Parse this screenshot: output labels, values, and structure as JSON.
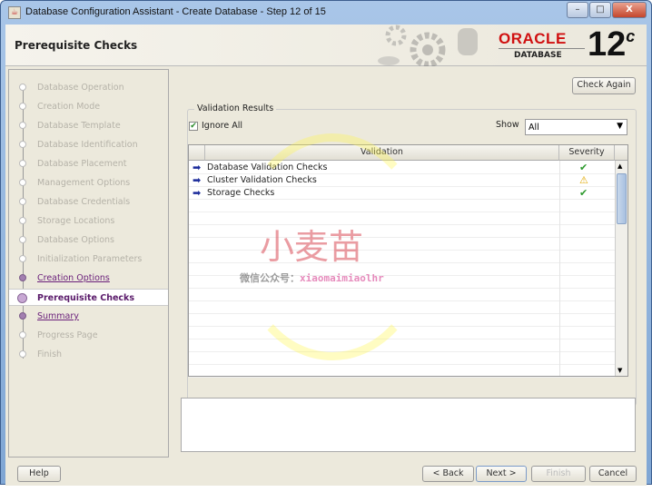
{
  "window": {
    "title": "Database Configuration Assistant - Create Database - Step 12 of 15",
    "minimize": "–",
    "maximize": "□",
    "close": "X"
  },
  "header": {
    "page_title": "Prerequisite Checks",
    "brand": "ORACLE",
    "product": "DATABASE",
    "version": "12",
    "version_suffix": "c"
  },
  "sidebar": {
    "steps": [
      {
        "label": "Database Operation",
        "state": "disabled"
      },
      {
        "label": "Creation Mode",
        "state": "disabled"
      },
      {
        "label": "Database Template",
        "state": "disabled"
      },
      {
        "label": "Database Identification",
        "state": "disabled"
      },
      {
        "label": "Database Placement",
        "state": "disabled"
      },
      {
        "label": "Management Options",
        "state": "disabled"
      },
      {
        "label": "Database Credentials",
        "state": "disabled"
      },
      {
        "label": "Storage Locations",
        "state": "disabled"
      },
      {
        "label": "Database Options",
        "state": "disabled"
      },
      {
        "label": "Initialization Parameters",
        "state": "disabled"
      },
      {
        "label": "Creation Options",
        "state": "link"
      },
      {
        "label": "Prerequisite Checks",
        "state": "current"
      },
      {
        "label": "Summary",
        "state": "link"
      },
      {
        "label": "Progress Page",
        "state": "disabled"
      },
      {
        "label": "Finish",
        "state": "disabled"
      }
    ]
  },
  "main": {
    "check_again": "Check Again",
    "group_title": "Validation Results",
    "ignore_all": "Ignore All",
    "ignore_all_checked": true,
    "show_label": "Show",
    "show_value": "All",
    "columns": [
      "Validation",
      "Severity"
    ],
    "rows": [
      {
        "name": "Database Validation Checks",
        "severity": "success"
      },
      {
        "name": "Cluster Validation Checks",
        "severity": "warning"
      },
      {
        "name": "Storage Checks",
        "severity": "success"
      }
    ]
  },
  "footer": {
    "help": "Help",
    "back": "< Back",
    "next": "Next >",
    "finish": "Finish",
    "cancel": "Cancel"
  },
  "watermark": {
    "title": "小麦苗",
    "subtitle_prefix": "微信公众号：",
    "subtitle_id": "xiaomaimiaolhr"
  },
  "colors": {
    "link": "#6a1f7a",
    "oracle_red": "#d01010",
    "success": "#2e9a2e",
    "warning": "#e0a800"
  }
}
